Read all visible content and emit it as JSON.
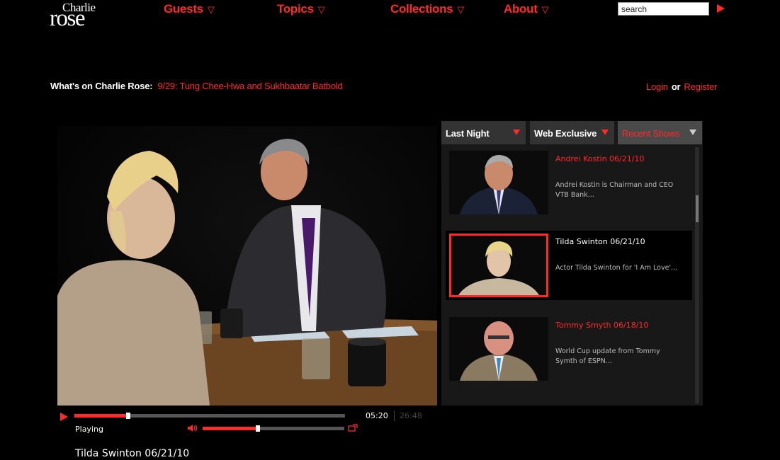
{
  "logo": {
    "line1": "Charlie",
    "line2": "rose"
  },
  "nav": {
    "items": [
      {
        "label": "Guests",
        "arrow": "▽"
      },
      {
        "label": "Topics",
        "arrow": "▽"
      },
      {
        "label": "Collections",
        "arrow": "▽"
      },
      {
        "label": "About",
        "arrow": "▽"
      }
    ]
  },
  "search": {
    "value": "search"
  },
  "whats_on": {
    "label": "What's on Charlie Rose:",
    "link": "9/29: Tung Chee-Hwa and Sukhbaatar Batbold"
  },
  "auth": {
    "login": "Login",
    "or": "or",
    "register": "Register"
  },
  "player": {
    "progress": 0.2,
    "volume": 0.39,
    "current_time": "05:20",
    "total_time": "26:48",
    "status": "Playing",
    "now_title": "Tilda Swinton 06/21/10"
  },
  "panel": {
    "tabs": [
      {
        "label": "Last Night",
        "active": false
      },
      {
        "label": "Web Exclusive",
        "active": false
      },
      {
        "label": "Recent Shows",
        "active": true
      }
    ],
    "items": [
      {
        "title": "Andrei Kostin 06/21/10",
        "desc": "Andrei Kostin is Chairman and CEO VTB Bank...",
        "selected": false
      },
      {
        "title": "Tilda Swinton 06/21/10",
        "desc": "Actor Tilda Swinton for 'I Am Love'...",
        "selected": true
      },
      {
        "title": "Tommy Smyth 06/18/10",
        "desc": "World Cup update from Tommy Symth of ESPN...",
        "selected": false
      }
    ]
  },
  "colors": {
    "accent": "#ff2a2a",
    "background": "#000000",
    "panel": "#181818"
  },
  "icons": [
    "play-icon",
    "volume-icon",
    "fullscreen-icon",
    "dropdown-arrow-icon"
  ]
}
